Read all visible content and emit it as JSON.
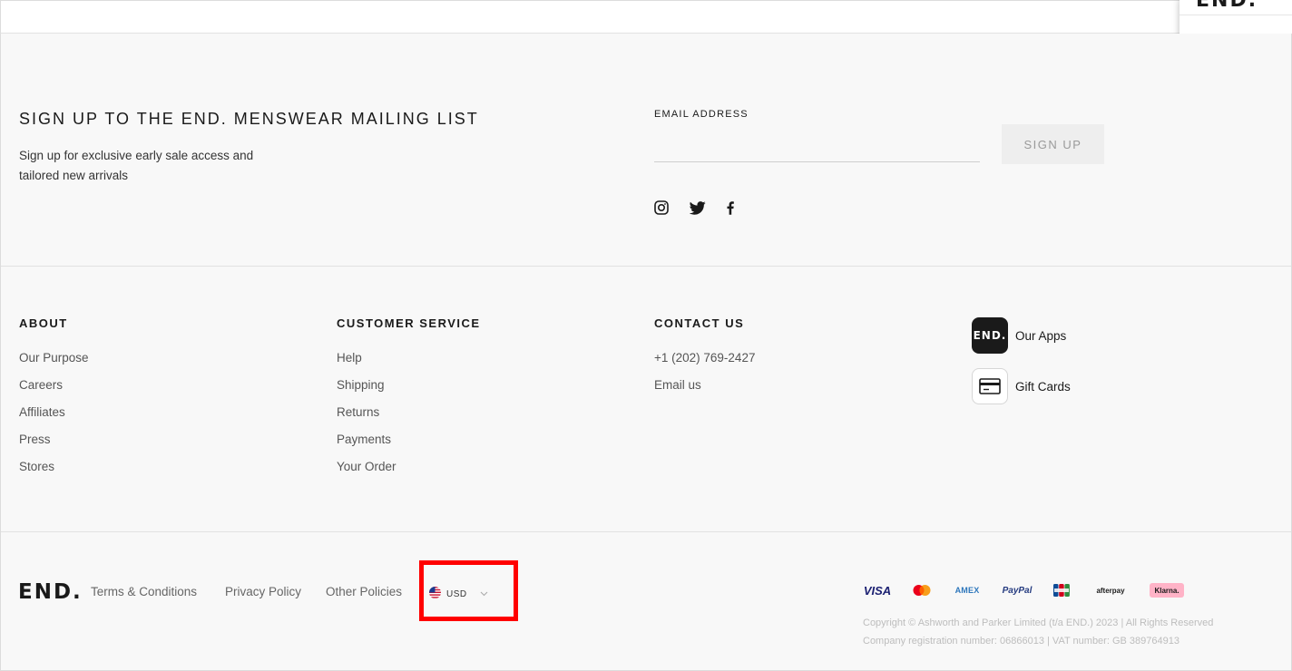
{
  "popup": {
    "logo_fragment": "END."
  },
  "signup": {
    "title": "SIGN UP TO THE END. MENSWEAR MAILING LIST",
    "description": "Sign up for exclusive early sale access and tailored new arrivals",
    "email_label": "EMAIL ADDRESS",
    "email_value": "",
    "button_label": "SIGN UP"
  },
  "social": [
    {
      "icon": "instagram-icon"
    },
    {
      "icon": "twitter-icon"
    },
    {
      "icon": "facebook-icon"
    }
  ],
  "columns": {
    "about": {
      "heading": "ABOUT",
      "items": [
        "Our Purpose",
        "Careers",
        "Affiliates",
        "Press",
        "Stores"
      ]
    },
    "customer_service": {
      "heading": "CUSTOMER SERVICE",
      "items": [
        "Help",
        "Shipping",
        "Returns",
        "Payments",
        "Your Order"
      ]
    },
    "contact": {
      "heading": "CONTACT US",
      "items": [
        "+1 (202) 769-2427",
        "Email us"
      ]
    }
  },
  "apps": {
    "our_apps": {
      "badge": "END.",
      "label": "Our Apps"
    },
    "gift_cards": {
      "icon": "credit-card-icon",
      "label": "Gift Cards"
    }
  },
  "bottom": {
    "logo": "END.",
    "links": [
      "Terms & Conditions",
      "Privacy Policy",
      "Other Policies"
    ],
    "currency": {
      "flag": "us-flag-icon",
      "code": "USD"
    }
  },
  "payments": [
    "VISA",
    "Mastercard",
    "AMEX",
    "PayPal",
    "JCB",
    "afterpay",
    "Klarna."
  ],
  "copyright": {
    "line1": "Copyright © Ashworth and Parker Limited (t/a END.) 2023 | All Rights Reserved",
    "line2": "Company registration number: 06866013 | VAT number: GB 389764913"
  },
  "colors": {
    "highlight": "#ff0000",
    "footer_bg": "#f8f8f8",
    "text": "#1a1a1a",
    "klarna": "#ffb3c7"
  }
}
